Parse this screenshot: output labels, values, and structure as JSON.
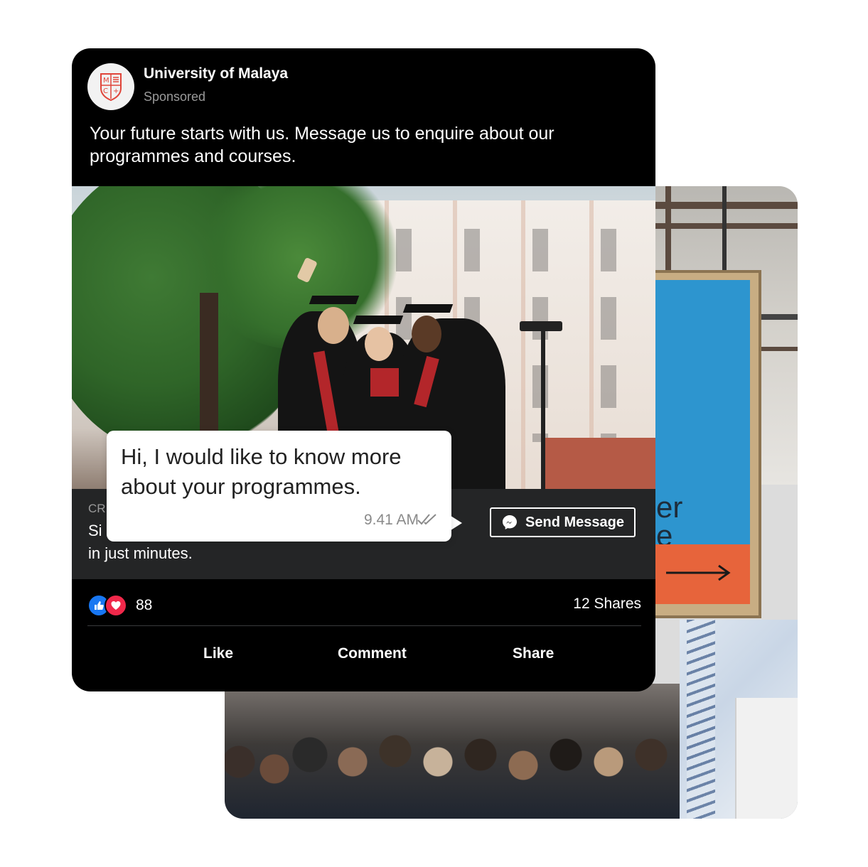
{
  "post": {
    "page_name": "University of Malaya",
    "sponsored_label": "Sponsored",
    "text": "Your future starts with us. Message us to enquire about our programmes and courses.",
    "cta": {
      "small_label": "CR",
      "line1": "Si",
      "line2": "in just minutes.",
      "button_label": "Send Message"
    },
    "reactions": {
      "count": "88",
      "icons": [
        "like-icon",
        "love-icon"
      ]
    },
    "shares": "12 Shares",
    "actions": {
      "like": "Like",
      "comment": "Comment",
      "share": "Share"
    }
  },
  "chat_bubble": {
    "text": "Hi, I would like to know more about your programmes.",
    "time": "9.41 AM",
    "status_icon": "double-check-icon"
  },
  "background_sign": {
    "letters": "er\ne"
  },
  "colors": {
    "post_bg": "#000000",
    "cta_bg": "#242526",
    "like_blue": "#1877f2",
    "love_red": "#f0284a",
    "logo_red": "#e0453a"
  }
}
